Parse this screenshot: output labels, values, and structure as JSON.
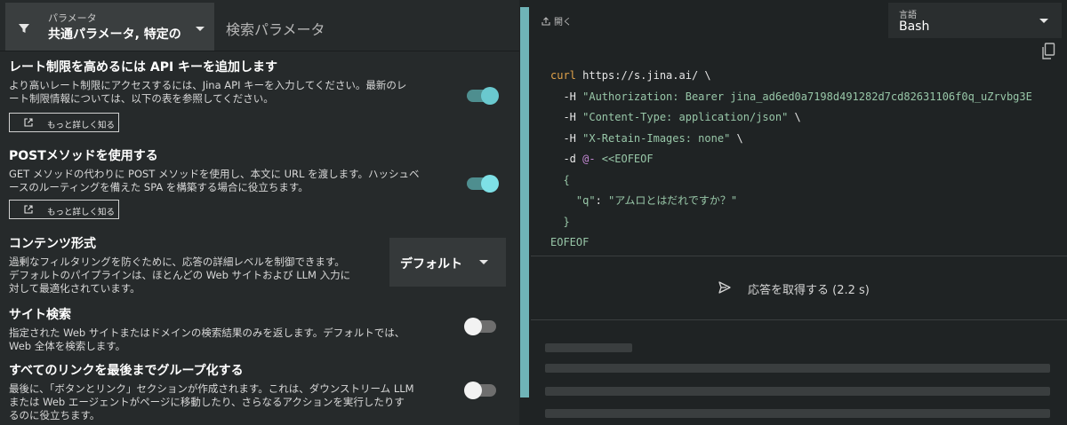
{
  "left": {
    "param_select": {
      "label": "パラメータ",
      "value": "共通パラメータ, 特定の"
    },
    "search_param_label": "検索パラメータ",
    "sections": [
      {
        "title": "レート制限を高めるには API キーを追加します",
        "desc1": "より高いレート制限にアクセスするには、Jina API キーを入力してください。最新のレ",
        "desc2": "ート制限情報については、以下の表を参照してください。",
        "more": "もっと詳しく知る",
        "toggle": "on"
      },
      {
        "title": "POSTメソッドを使用する",
        "desc1": "GET メソッドの代わりに POST メソッドを使用し、本文に URL を渡します。ハッシュベ",
        "desc2": "ースのルーティングを備えた SPA を構築する場合に役立ちます。",
        "more": "もっと詳しく知る",
        "toggle": "on"
      },
      {
        "title": "コンテンツ形式",
        "desc1": "過剰なフィルタリングを防ぐために、応答の詳細レベルを制御できます。",
        "desc2": "デフォルトのパイプラインは、ほとんどの Web サイトおよび LLM 入力に",
        "desc3": "対して最適化されています。",
        "select_value": "デフォルト"
      },
      {
        "title": "サイト検索",
        "desc1": "指定された Web サイトまたはドメインの検索結果のみを返します。デフォルトでは、",
        "desc2": "Web 全体を検索します。",
        "toggle": "off"
      },
      {
        "title": "すべてのリンクを最後までグループ化する",
        "desc1": "最後に、「ボタンとリンク」セクションが作成されます。これは、ダウンストリーム LLM",
        "desc2": "または Web エージェントがページに移動したり、さらなるアクションを実行したりす",
        "desc3": "るのに役立ちます。",
        "toggle": "off"
      }
    ]
  },
  "right": {
    "open_label": "開く",
    "lang_select": {
      "label": "言語",
      "value": "Bash"
    },
    "code": {
      "l1_cmd": "curl",
      "l1_url": " https://s.jina.ai/ \\",
      "l2_flag": "  -H ",
      "l2_val": "\"Authorization: Bearer jina_ad6ed0a7198d491282d7cd82631106f0q_uZrvbg3E",
      "l3_flag": "  -H ",
      "l3_val": "\"Content-Type: application/json\"",
      "l3_tail": " \\",
      "l4_flag": "  -H ",
      "l4_val": "\"X-Retain-Images: none\"",
      "l4_tail": " \\",
      "l5_flag": "  -d ",
      "l5_at": "@-",
      "l5_heredoc": " <<EOFEOF",
      "l6": "  {",
      "l7_key": "    \"q\"",
      "l7_colon": ": ",
      "l7_val": "\"アムロとはだれですか？\"",
      "l8": "  }",
      "l9": "EOFEOF"
    },
    "send_label": "応答を取得する (2.2 s)"
  },
  "colors": {
    "accent": "#6ac9cf",
    "keyword": "#e0a24a",
    "string": "#98c7a8"
  },
  "icons": [
    "filter-icon",
    "external-link-icon",
    "upload-icon",
    "copy-icon",
    "send-icon"
  ]
}
